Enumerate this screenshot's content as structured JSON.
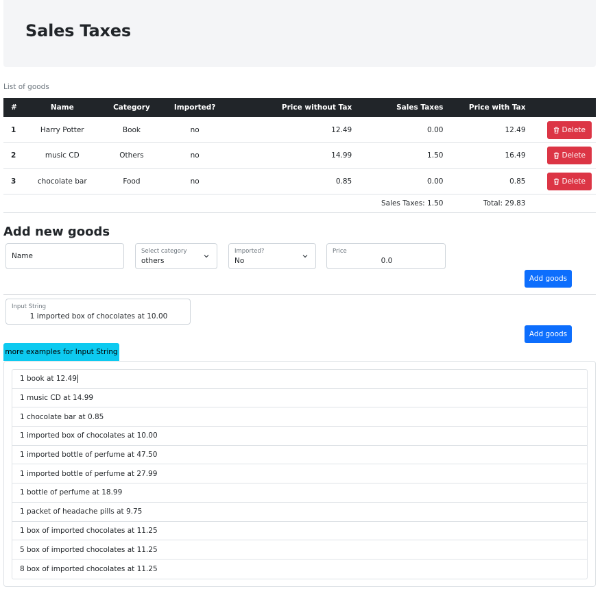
{
  "header": {
    "title": "Sales Taxes"
  },
  "table": {
    "caption": "List of goods",
    "columns": [
      "#",
      "Name",
      "Category",
      "Imported?",
      "Price without Tax",
      "Sales Taxes",
      "Price with Tax"
    ],
    "rows": [
      {
        "num": "1",
        "name": "Harry Potter",
        "category": "Book",
        "imported": "no",
        "price_without_tax": "12.49",
        "sales_taxes": "0.00",
        "price_with_tax": "12.49",
        "delete_label": "Delete"
      },
      {
        "num": "2",
        "name": "music CD",
        "category": "Others",
        "imported": "no",
        "price_without_tax": "14.99",
        "sales_taxes": "1.50",
        "price_with_tax": "16.49",
        "delete_label": "Delete"
      },
      {
        "num": "3",
        "name": "chocolate bar",
        "category": "Food",
        "imported": "no",
        "price_without_tax": "0.85",
        "sales_taxes": "0.00",
        "price_with_tax": "0.85",
        "delete_label": "Delete"
      }
    ],
    "footer": {
      "sales_taxes": "Sales Taxes: 1.50",
      "total": "Total: 29.83"
    }
  },
  "add_form": {
    "heading": "Add new goods",
    "name_placeholder": "Name",
    "category_label": "Select category",
    "category_value": "others",
    "imported_label": "Imported?",
    "imported_value": "No",
    "price_label": "Price",
    "price_value": "0.0",
    "submit_label": "Add goods"
  },
  "input_string": {
    "label": "Input String",
    "value": "1 imported box of chocolates at 10.00",
    "submit_label": "Add goods"
  },
  "examples": {
    "toggle_label": "more examples for Input String",
    "items": [
      "1 book at 12.49",
      "1 music CD at 14.99",
      "1 chocolate bar at 0.85",
      "1 imported box of chocolates at 10.00",
      "1 imported bottle of perfume at 47.50",
      "1 imported bottle of perfume at 27.99",
      "1 bottle of perfume at 18.99",
      "1 packet of headache pills at 9.75",
      "1 box of imported chocolates at 11.25",
      "5 box of imported chocolates at 11.25",
      "8 box of imported chocolates at 11.25"
    ]
  },
  "colors": {
    "danger": "#dc3545",
    "primary": "#0d6efd",
    "info": "#0dcaf0",
    "table_head": "#212529"
  }
}
